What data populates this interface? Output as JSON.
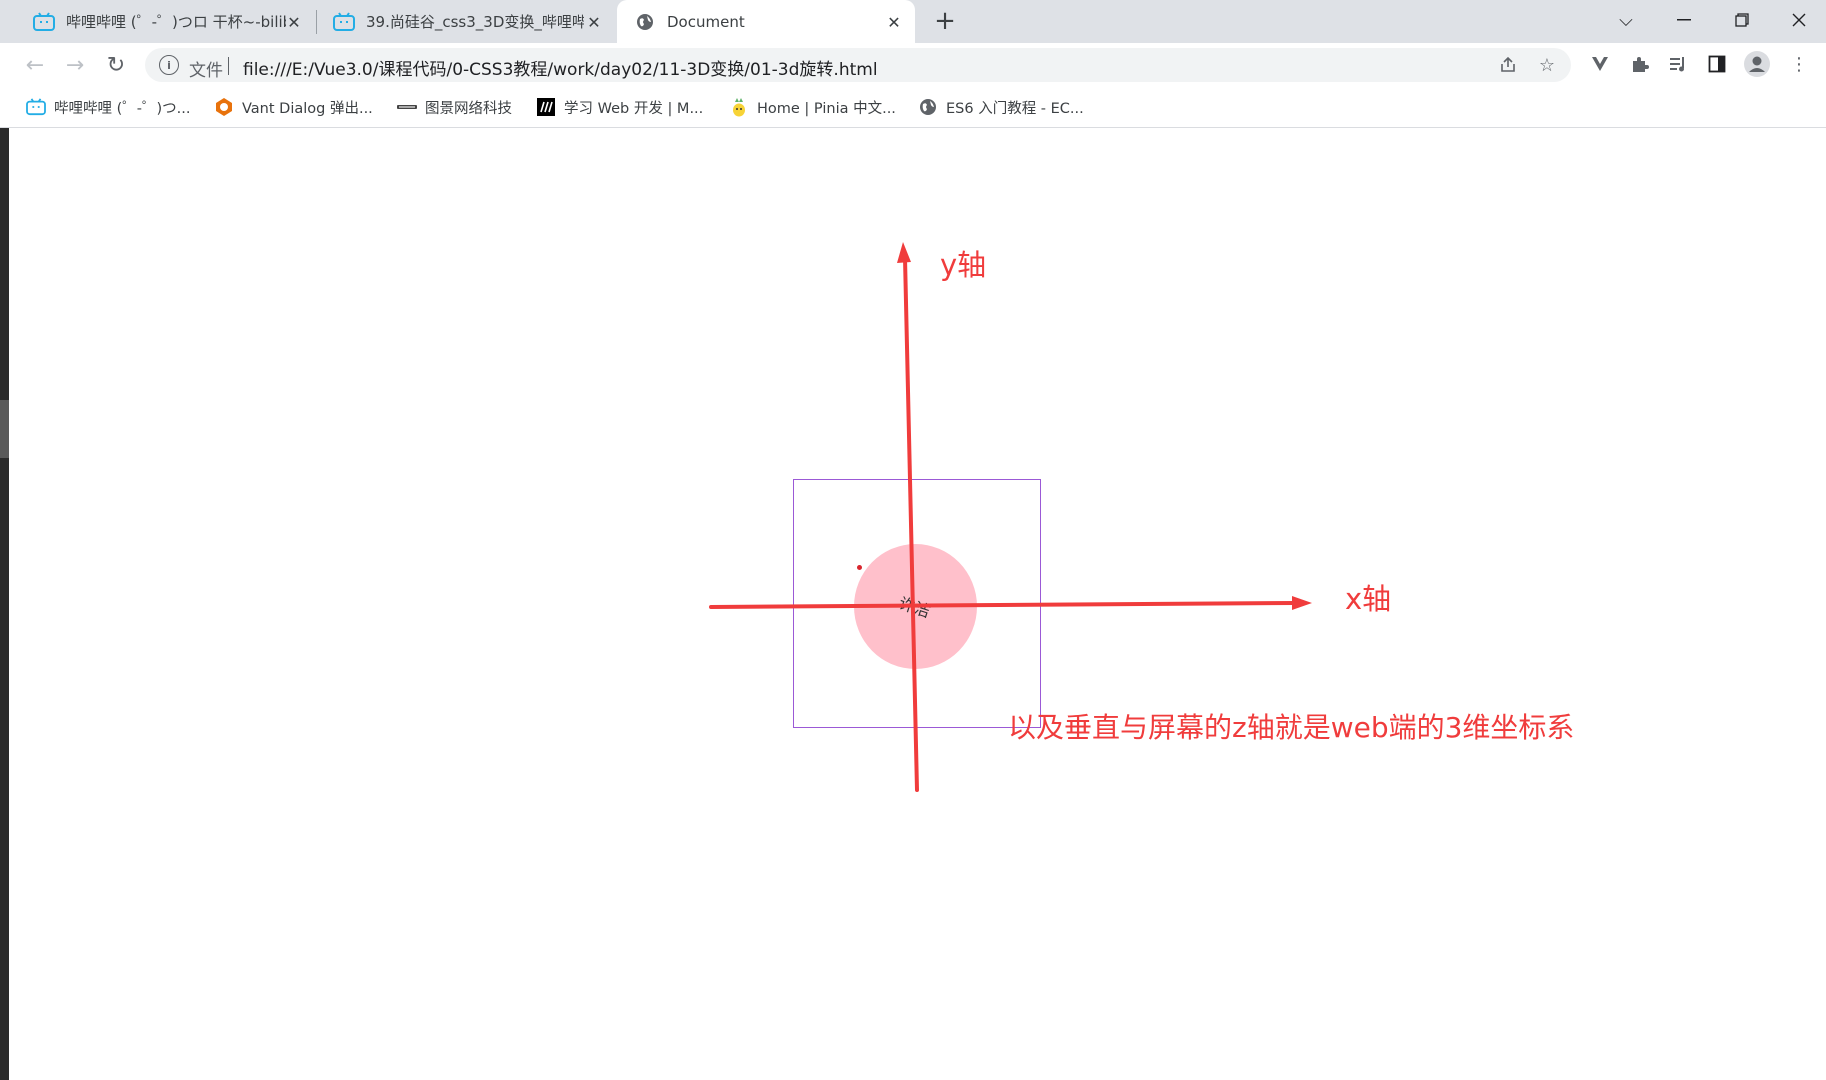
{
  "tabs": [
    {
      "title": "哔哩哔哩 (゜-゜)つロ 干杯~-bilibili",
      "icon": "bilibili-tv-icon"
    },
    {
      "title": "39.尚硅谷_css3_3D变换_哔哩哔哩",
      "icon": "bilibili-tv-icon"
    },
    {
      "title": "Document",
      "icon": "globe-icon",
      "active": true
    }
  ],
  "toolbar": {
    "scheme_label": "文件",
    "url": "file:///E:/Vue3.0/课程代码/0-CSS3教程/work/day02/11-3D变换/01-3d旋转.html"
  },
  "bookmarks": [
    {
      "label": "哔哩哔哩 (゜-゜)つ...",
      "icon": "bilibili-tv-icon"
    },
    {
      "label": "Vant Dialog 弹出...",
      "icon": "vant-logo-icon"
    },
    {
      "label": "图景网络科技",
      "icon": "tujing-logo-icon"
    },
    {
      "label": "学习 Web 开发 | M...",
      "icon": "mdn-logo-icon"
    },
    {
      "label": "Home | Pinia 中文...",
      "icon": "pinia-logo-icon"
    },
    {
      "label": "ES6 入门教程 - EC...",
      "icon": "globe-icon"
    }
  ],
  "page": {
    "circle_text": "许洁",
    "annotations": {
      "y_axis": "y轴",
      "x_axis": "x轴",
      "z_axis_note": "以及垂直与屏幕的z轴就是web端的3维坐标系"
    }
  },
  "colors": {
    "annotation_red": "#f03c3c",
    "box_border": "#9b59d6",
    "circle_fill": "#ffc0cb",
    "tabstrip": "#dee1e6"
  }
}
